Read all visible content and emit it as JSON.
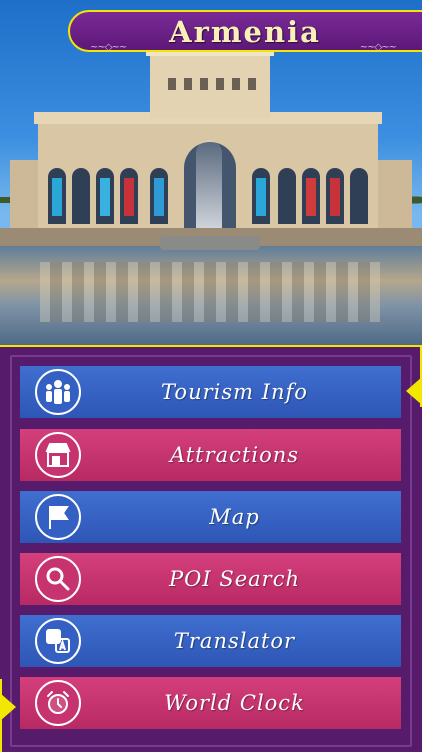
{
  "header": {
    "title": "Armenia"
  },
  "colors": {
    "banner_bg": "#6a1f86",
    "banner_border": "#f3e600",
    "panel_bg": "#561c6b",
    "button_blue": "#3462c5",
    "button_pink": "#c6336e"
  },
  "menu": {
    "items": [
      {
        "label": "Tourism Info",
        "icon": "group-people-icon",
        "color": "blue"
      },
      {
        "label": "Attractions",
        "icon": "storefront-icon",
        "color": "pink"
      },
      {
        "label": "Map",
        "icon": "flag-icon",
        "color": "blue"
      },
      {
        "label": "POI Search",
        "icon": "magnifier-icon",
        "color": "pink"
      },
      {
        "label": "Translator",
        "icon": "translate-icon",
        "color": "blue"
      },
      {
        "label": "World Clock",
        "icon": "alarm-clock-icon",
        "color": "pink"
      }
    ]
  }
}
